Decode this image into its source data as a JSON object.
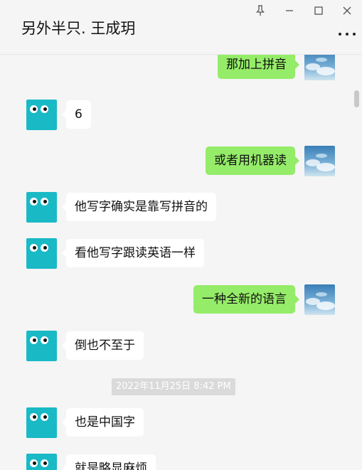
{
  "header": {
    "title": "另外半只. 王成玥",
    "pin_icon": "pin-icon",
    "minimize_icon": "minimize-icon",
    "maximize_icon": "maximize-icon",
    "close_icon": "close-icon",
    "more_icon": "more-icon"
  },
  "colors": {
    "sent_bubble": "#95ec69",
    "received_bubble": "#ffffff",
    "contact_avatar": "#19b9c6",
    "background": "#f5f5f5"
  },
  "messages": [
    {
      "side": "right",
      "text": "那加上拼音"
    },
    {
      "side": "left",
      "text": "6"
    },
    {
      "side": "right",
      "text": "或者用机器读"
    },
    {
      "side": "left",
      "text": "他写字确实是靠写拼音的"
    },
    {
      "side": "left",
      "text": "看他写字跟读英语一样"
    },
    {
      "side": "right",
      "text": "一种全新的语言"
    },
    {
      "side": "left",
      "text": "倒也不至于"
    },
    {
      "side": "left",
      "text": "也是中国字"
    },
    {
      "side": "left",
      "text": "就是略显麻烦"
    }
  ],
  "timestamp": "2022年11月25日 8:42 PM"
}
